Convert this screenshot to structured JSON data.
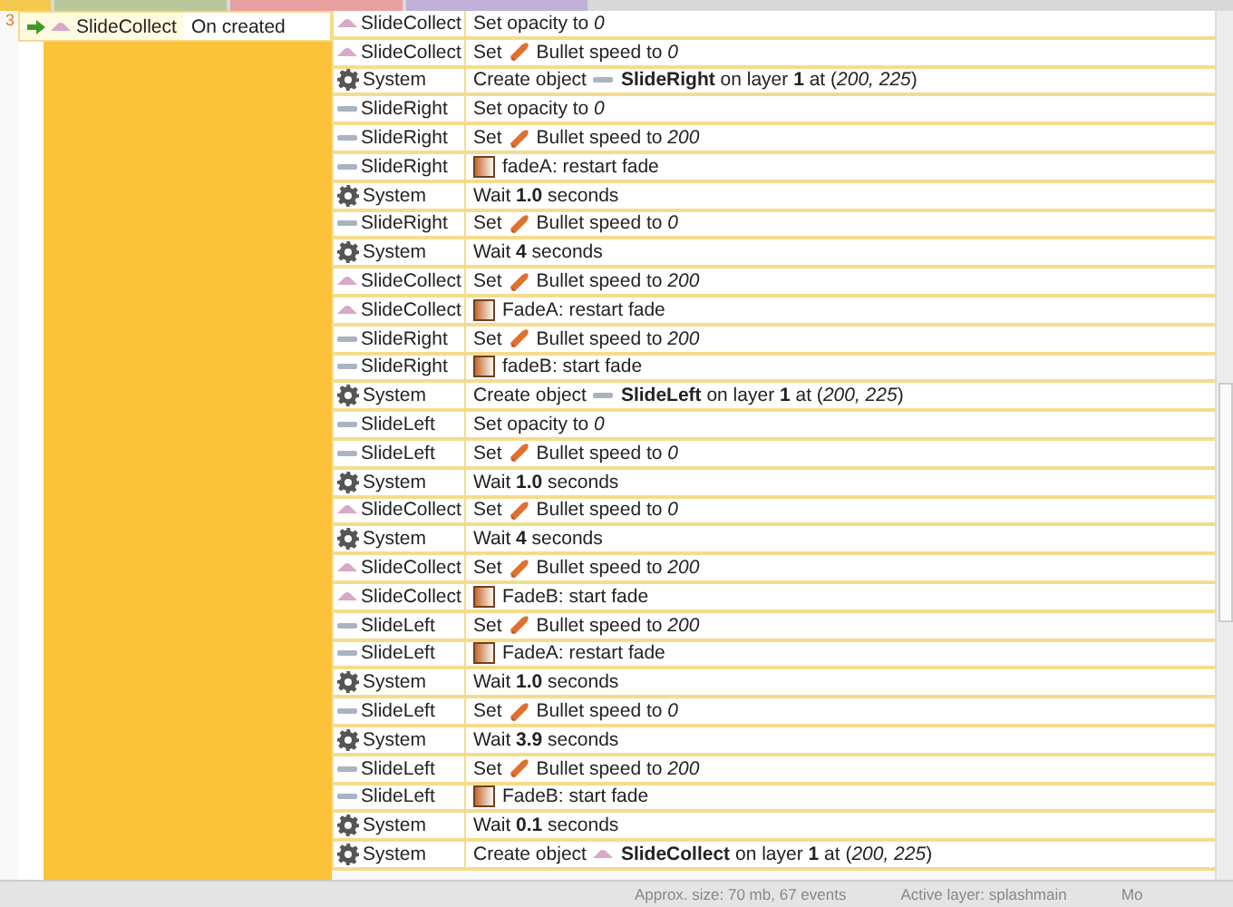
{
  "event": {
    "number": "3",
    "condition": {
      "object": {
        "kind": "sprite",
        "name": "SlideCollect"
      },
      "text": "On created"
    }
  },
  "actions": [
    {
      "object": {
        "kind": "sprite",
        "name": "SlideCollect"
      },
      "parts": [
        {
          "kind": "text",
          "text": "Set opacity to *0*"
        }
      ]
    },
    {
      "object": {
        "kind": "sprite",
        "name": "SlideCollect"
      },
      "parts": [
        {
          "kind": "text",
          "text": "Set"
        },
        {
          "kind": "bullet"
        },
        {
          "kind": "text",
          "text": "Bullet speed to *0*"
        }
      ]
    },
    {
      "object": {
        "kind": "gear",
        "name": "System"
      },
      "parts": [
        {
          "kind": "text",
          "text": "Create object"
        },
        {
          "kind": "bar"
        },
        {
          "kind": "text",
          "text": "**SlideRight** on layer **1** at (*200, 225*)"
        }
      ]
    },
    {
      "object": {
        "kind": "bar",
        "name": "SlideRight"
      },
      "parts": [
        {
          "kind": "text",
          "text": "Set opacity to *0*"
        }
      ]
    },
    {
      "object": {
        "kind": "bar",
        "name": "SlideRight"
      },
      "parts": [
        {
          "kind": "text",
          "text": "Set"
        },
        {
          "kind": "bullet"
        },
        {
          "kind": "text",
          "text": "Bullet speed to *200*"
        }
      ]
    },
    {
      "object": {
        "kind": "bar",
        "name": "SlideRight"
      },
      "parts": [
        {
          "kind": "fade"
        },
        {
          "kind": "text",
          "text": "fadeA: restart fade"
        }
      ]
    },
    {
      "object": {
        "kind": "gear",
        "name": "System"
      },
      "parts": [
        {
          "kind": "text",
          "text": "Wait **1.0** seconds"
        }
      ]
    },
    {
      "object": {
        "kind": "bar",
        "name": "SlideRight"
      },
      "parts": [
        {
          "kind": "text",
          "text": "Set"
        },
        {
          "kind": "bullet"
        },
        {
          "kind": "text",
          "text": "Bullet speed to *0*"
        }
      ]
    },
    {
      "object": {
        "kind": "gear",
        "name": "System"
      },
      "parts": [
        {
          "kind": "text",
          "text": "Wait **4** seconds"
        }
      ]
    },
    {
      "object": {
        "kind": "sprite",
        "name": "SlideCollect"
      },
      "parts": [
        {
          "kind": "text",
          "text": "Set"
        },
        {
          "kind": "bullet"
        },
        {
          "kind": "text",
          "text": "Bullet speed to *200*"
        }
      ]
    },
    {
      "object": {
        "kind": "sprite",
        "name": "SlideCollect"
      },
      "parts": [
        {
          "kind": "fade"
        },
        {
          "kind": "text",
          "text": "FadeA: restart fade"
        }
      ]
    },
    {
      "object": {
        "kind": "bar",
        "name": "SlideRight"
      },
      "parts": [
        {
          "kind": "text",
          "text": "Set"
        },
        {
          "kind": "bullet"
        },
        {
          "kind": "text",
          "text": "Bullet speed to *200*"
        }
      ]
    },
    {
      "object": {
        "kind": "bar",
        "name": "SlideRight"
      },
      "parts": [
        {
          "kind": "fade"
        },
        {
          "kind": "text",
          "text": "fadeB: start fade"
        }
      ]
    },
    {
      "object": {
        "kind": "gear",
        "name": "System"
      },
      "parts": [
        {
          "kind": "text",
          "text": "Create object"
        },
        {
          "kind": "bar"
        },
        {
          "kind": "text",
          "text": "**SlideLeft** on layer **1** at (*200, 225*)"
        }
      ]
    },
    {
      "object": {
        "kind": "bar",
        "name": "SlideLeft"
      },
      "parts": [
        {
          "kind": "text",
          "text": "Set opacity to *0*"
        }
      ]
    },
    {
      "object": {
        "kind": "bar",
        "name": "SlideLeft"
      },
      "parts": [
        {
          "kind": "text",
          "text": "Set"
        },
        {
          "kind": "bullet"
        },
        {
          "kind": "text",
          "text": "Bullet speed to *0*"
        }
      ]
    },
    {
      "object": {
        "kind": "gear",
        "name": "System"
      },
      "parts": [
        {
          "kind": "text",
          "text": "Wait **1.0** seconds"
        }
      ]
    },
    {
      "object": {
        "kind": "sprite",
        "name": "SlideCollect"
      },
      "parts": [
        {
          "kind": "text",
          "text": "Set"
        },
        {
          "kind": "bullet"
        },
        {
          "kind": "text",
          "text": "Bullet speed to *0*"
        }
      ]
    },
    {
      "object": {
        "kind": "gear",
        "name": "System"
      },
      "parts": [
        {
          "kind": "text",
          "text": "Wait **4** seconds"
        }
      ]
    },
    {
      "object": {
        "kind": "sprite",
        "name": "SlideCollect"
      },
      "parts": [
        {
          "kind": "text",
          "text": "Set"
        },
        {
          "kind": "bullet"
        },
        {
          "kind": "text",
          "text": "Bullet speed to *200*"
        }
      ]
    },
    {
      "object": {
        "kind": "sprite",
        "name": "SlideCollect"
      },
      "parts": [
        {
          "kind": "fade"
        },
        {
          "kind": "text",
          "text": "FadeB: start fade"
        }
      ]
    },
    {
      "object": {
        "kind": "bar",
        "name": "SlideLeft"
      },
      "parts": [
        {
          "kind": "text",
          "text": "Set"
        },
        {
          "kind": "bullet"
        },
        {
          "kind": "text",
          "text": "Bullet speed to *200*"
        }
      ]
    },
    {
      "object": {
        "kind": "bar",
        "name": "SlideLeft"
      },
      "parts": [
        {
          "kind": "fade"
        },
        {
          "kind": "text",
          "text": "FadeA: restart fade"
        }
      ]
    },
    {
      "object": {
        "kind": "gear",
        "name": "System"
      },
      "parts": [
        {
          "kind": "text",
          "text": "Wait **1.0** seconds"
        }
      ]
    },
    {
      "object": {
        "kind": "bar",
        "name": "SlideLeft"
      },
      "parts": [
        {
          "kind": "text",
          "text": "Set"
        },
        {
          "kind": "bullet"
        },
        {
          "kind": "text",
          "text": "Bullet speed to *0*"
        }
      ]
    },
    {
      "object": {
        "kind": "gear",
        "name": "System"
      },
      "parts": [
        {
          "kind": "text",
          "text": "Wait **3.9** seconds"
        }
      ]
    },
    {
      "object": {
        "kind": "bar",
        "name": "SlideLeft"
      },
      "parts": [
        {
          "kind": "text",
          "text": "Set"
        },
        {
          "kind": "bullet"
        },
        {
          "kind": "text",
          "text": "Bullet speed to *200*"
        }
      ]
    },
    {
      "object": {
        "kind": "bar",
        "name": "SlideLeft"
      },
      "parts": [
        {
          "kind": "fade"
        },
        {
          "kind": "text",
          "text": "FadeB: start fade"
        }
      ]
    },
    {
      "object": {
        "kind": "gear",
        "name": "System"
      },
      "parts": [
        {
          "kind": "text",
          "text": "Wait **0.1** seconds"
        }
      ]
    },
    {
      "object": {
        "kind": "gear",
        "name": "System"
      },
      "parts": [
        {
          "kind": "text",
          "text": "Create object"
        },
        {
          "kind": "sprite"
        },
        {
          "kind": "text",
          "text": "**SlideCollect** on layer **1** at (*200, 225*)"
        }
      ]
    }
  ],
  "status_bar": [
    "Approx. size: 70 mb, 67 events",
    "Active layer: splashmain",
    "Mo"
  ]
}
